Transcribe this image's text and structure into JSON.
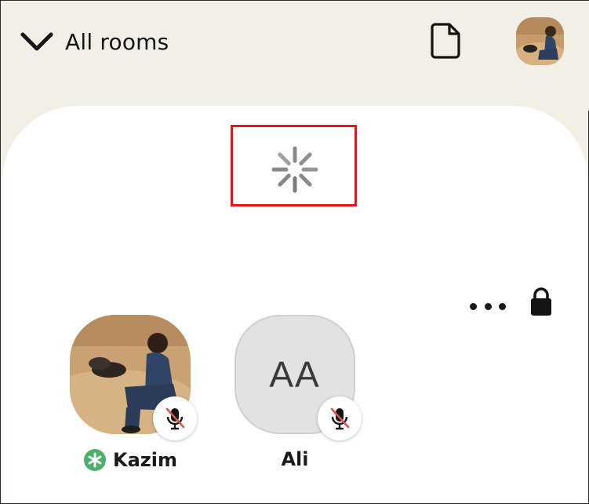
{
  "header": {
    "back_label": "All rooms",
    "back_icon": "chevron-down-icon",
    "doc_icon": "document-icon",
    "profile_avatar": "user-photo-avatar"
  },
  "room": {
    "status": "loading",
    "spinner_icon": "loading-spinner-icon",
    "highlight_color": "#e8141c",
    "more_icon": "more-options-icon",
    "lock_icon": "lock-icon"
  },
  "participants": [
    {
      "name": "Kazim",
      "avatar": "photo",
      "badge": "moderator-star-icon",
      "badge_color": "#4caf6a",
      "muted": true
    },
    {
      "name": "Ali",
      "avatar_initials": "AA",
      "muted": true
    }
  ],
  "colors": {
    "header_bg": "#f1efe6",
    "sheet_bg": "#ffffff",
    "mute_slash": "#d9534f"
  }
}
